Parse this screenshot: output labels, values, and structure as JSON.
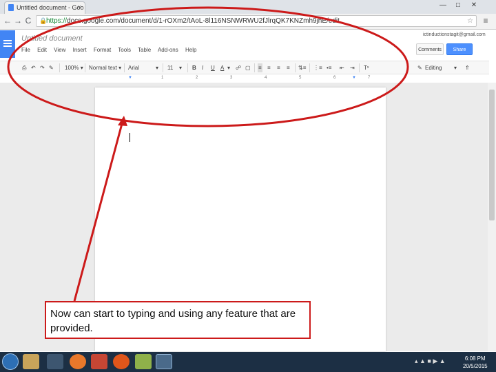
{
  "browser": {
    "tab_title": "Untitled document - Goo",
    "tab_close": "×",
    "window_buttons": [
      "—",
      "□",
      "✕"
    ],
    "url_https": "https://",
    "url_rest": "docs.google.com/document/d/1-rOXm2/tAoL-8l116NSNWRWU2fJlrqQK7KNZmh9jhE/edit",
    "nav": {
      "back": "←",
      "forward": "→",
      "reload": "C"
    },
    "menu_icon": "≡"
  },
  "docs": {
    "title": "Untitled document",
    "menu": [
      "File",
      "Edit",
      "View",
      "Insert",
      "Format",
      "Tools",
      "Table",
      "Add-ons",
      "Help"
    ],
    "account": "ictinductionstagit@gmail.com",
    "comments_label": "Comments",
    "share_label": "Share",
    "toolbar": {
      "zoom": "100%",
      "style": "Normal text",
      "font": "Arial",
      "size": "11",
      "bold": "B",
      "italic": "I",
      "underline": "U",
      "text_color": "A",
      "mode": "Editing"
    },
    "ruler_marks": [
      "1",
      "2",
      "3",
      "4",
      "5",
      "6",
      "7"
    ]
  },
  "annotation": {
    "text": "Now can start to typing and using any feature that are provided.",
    "color": "#cc1a1a"
  },
  "taskbar": {
    "time": "6:08 PM",
    "date": "20/5/2015"
  }
}
